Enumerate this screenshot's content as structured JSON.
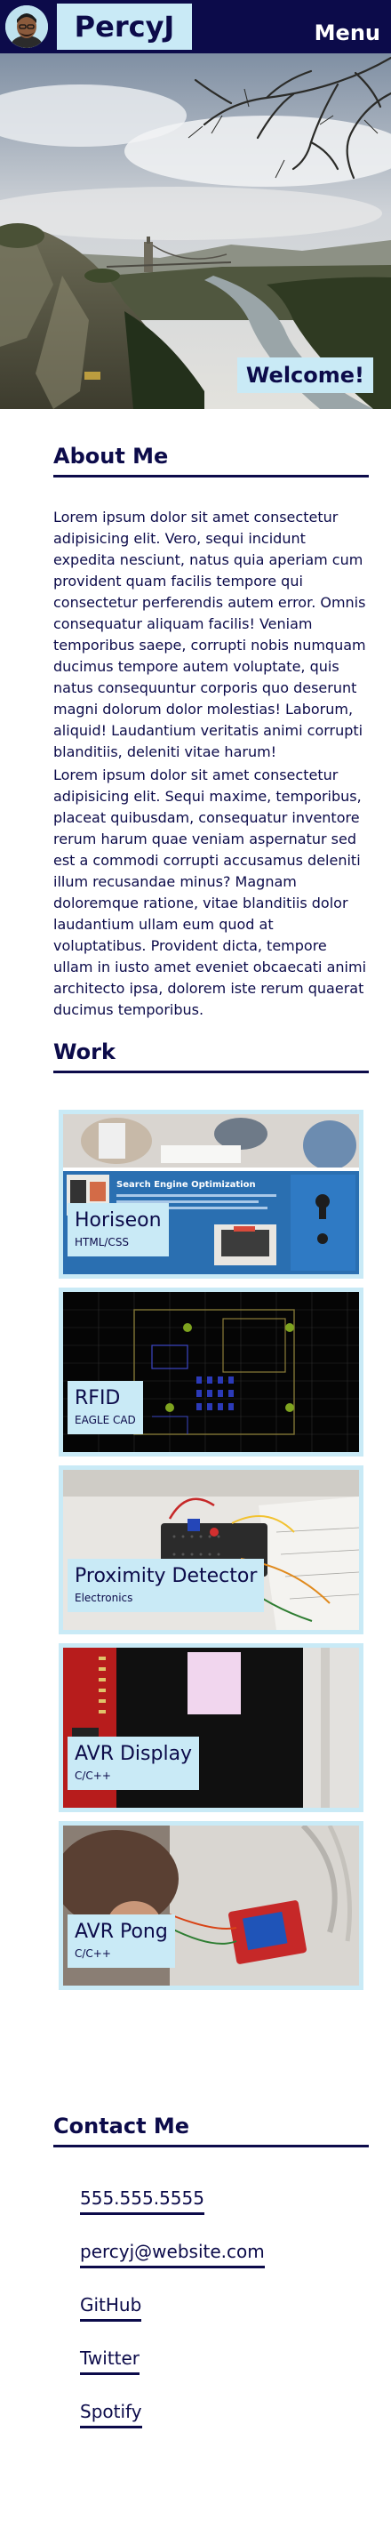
{
  "header": {
    "brand": "PercyJ",
    "menu_label": "Menu"
  },
  "hero": {
    "welcome": "Welcome!"
  },
  "about": {
    "title": "About Me",
    "paragraphs": [
      "Lorem ipsum dolor sit amet consectetur adipisicing elit. Vero, sequi incidunt expedita nesciunt, natus quia aperiam cum provident quam facilis tempore qui consectetur perferendis autem error. Omnis consequatur aliquam facilis! Veniam temporibus saepe, corrupti nobis numquam ducimus tempore autem voluptate, quis natus consequuntur corporis quo deserunt magni dolorum dolor molestias! Laborum, aliquid! Laudantium veritatis animi corrupti blanditiis, deleniti vitae harum!",
      "Lorem ipsum dolor sit amet consectetur adipisicing elit. Sequi maxime, temporibus, placeat quibusdam, consequatur inventore rerum harum quae veniam aspernatur sed est a commodi corrupti accusamus deleniti illum recusandae minus? Magnam doloremque ratione, vitae blanditiis dolor laudantium ullam eum quod at voluptatibus. Provident dicta, tempore ullam in iusto amet eveniet obcaecati animi architecto ipsa, dolorem iste rerum quaerat ducimus temporibus."
    ]
  },
  "work": {
    "title": "Work",
    "items": [
      {
        "title": "Horiseon",
        "subtitle": "HTML/CSS"
      },
      {
        "title": "RFID",
        "subtitle": "EAGLE CAD"
      },
      {
        "title": "Proximity Detector",
        "subtitle": "Electronics"
      },
      {
        "title": "AVR Display",
        "subtitle": "C/C++"
      },
      {
        "title": "AVR Pong",
        "subtitle": "C/C++"
      }
    ],
    "horiseon_banner": "Search Engine Optimization"
  },
  "contact": {
    "title": "Contact Me",
    "links": [
      "555.555.5555",
      "percyj@website.com",
      "GitHub",
      "Twitter",
      "Spotify"
    ]
  },
  "colors": {
    "navy": "#0c0b4a",
    "light_blue": "#c9eaf6"
  },
  "icons": [
    "avatar",
    "hero-photo",
    "project-thumbnail"
  ]
}
